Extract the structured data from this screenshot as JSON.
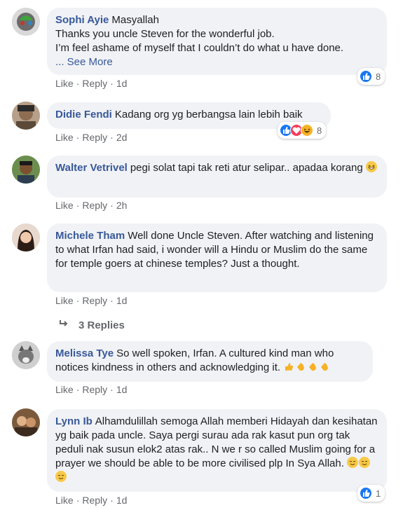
{
  "comments": [
    {
      "author": "Sophi Ayie",
      "text": "Masyallah\nThanks you uncle Steven for the wonderful job.\nI’m feel ashame of myself that I couldn’t do what u have done.",
      "more": "... See More",
      "like": "Like",
      "reply": "Reply",
      "time": "1d",
      "reaction_count": "8"
    },
    {
      "author": "Didie Fendi",
      "text": "Kadang org yg berbangsa lain lebih baik",
      "like": "Like",
      "reply": "Reply",
      "time": "2d",
      "reaction_count": "8"
    },
    {
      "author": "Walter Vetrivel",
      "text": "pegi solat tapi tak reti atur selipar.. apadaa korang",
      "like": "Like",
      "reply": "Reply",
      "time": "2h"
    },
    {
      "author": "Michele Tham",
      "text": "Well done Uncle Steven. After watching and listening to what Irfan had said, i wonder will a Hindu or Muslim do the same for temple goers at chinese temples? Just a thought.",
      "like": "Like",
      "reply": "Reply",
      "time": "1d",
      "replies_label": "3 Replies"
    },
    {
      "author": "Melissa Tye",
      "text": "So well spoken, Irfan. A cultured kind man who notices kindness in others and acknowledging it.",
      "like": "Like",
      "reply": "Reply",
      "time": "1d"
    },
    {
      "author": "Lynn Ib",
      "text": "Alhamdulillah semoga Allah memberi Hidayah dan kesihatan yg baik pada uncle. Saya pergi surau ada rak kasut pun org tak peduli nak susun elok2 atas rak.. N we r so called Muslim going for a prayer we should be able to be more civilised plp In Sya Allah.",
      "like": "Like",
      "reply": "Reply",
      "time": "1d",
      "reaction_count": "1"
    }
  ],
  "colors": {
    "author": "#385898",
    "bubble": "#f0f2f5",
    "meta": "#65676b",
    "like_blue": "#1877f2",
    "love_red": "#f33e58",
    "haha_yellow": "#f7b125"
  },
  "icons": [
    "like-icon",
    "love-icon",
    "haha-icon",
    "grin-emoji",
    "clap-emoji",
    "thumbs-up-emoji",
    "relieved-emoji",
    "reply-arrow-icon"
  ]
}
